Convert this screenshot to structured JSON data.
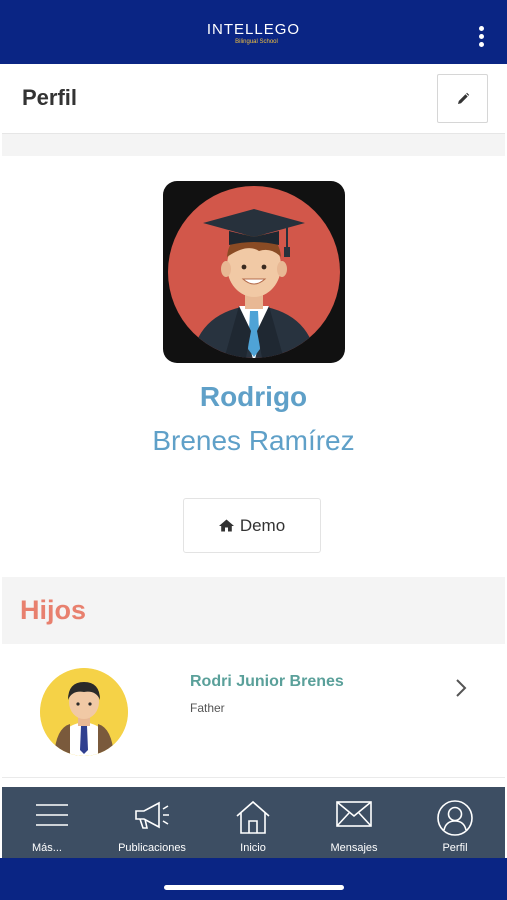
{
  "app": {
    "brand_name": "INTELLEGO",
    "brand_subtitle": "Bilingual School"
  },
  "header": {
    "title": "Perfil",
    "edit_icon": "pencil-icon",
    "menu_icon": "kebab-menu-icon"
  },
  "profile": {
    "first_name": "Rodrigo",
    "last_name": "Brenes Ramírez",
    "school_button_label": "Demo",
    "school_button_icon": "home-icon"
  },
  "children_section": {
    "title": "Hijos",
    "items": [
      {
        "name": "Rodri Junior Brenes",
        "relation": "Father"
      }
    ]
  },
  "tabbar": {
    "items": [
      {
        "label": "Más...",
        "icon": "hamburger-icon"
      },
      {
        "label": "Publicaciones",
        "icon": "megaphone-icon"
      },
      {
        "label": "Inicio",
        "icon": "home-icon"
      },
      {
        "label": "Mensajes",
        "icon": "envelope-icon"
      },
      {
        "label": "Perfil",
        "icon": "user-circle-icon"
      }
    ]
  },
  "colors": {
    "brand_blue": "#0a2584",
    "name_blue": "#5fa0c8",
    "section_title": "#e8806e",
    "child_name": "#5aa09a",
    "tabbar_bg": "#3d4e63"
  }
}
